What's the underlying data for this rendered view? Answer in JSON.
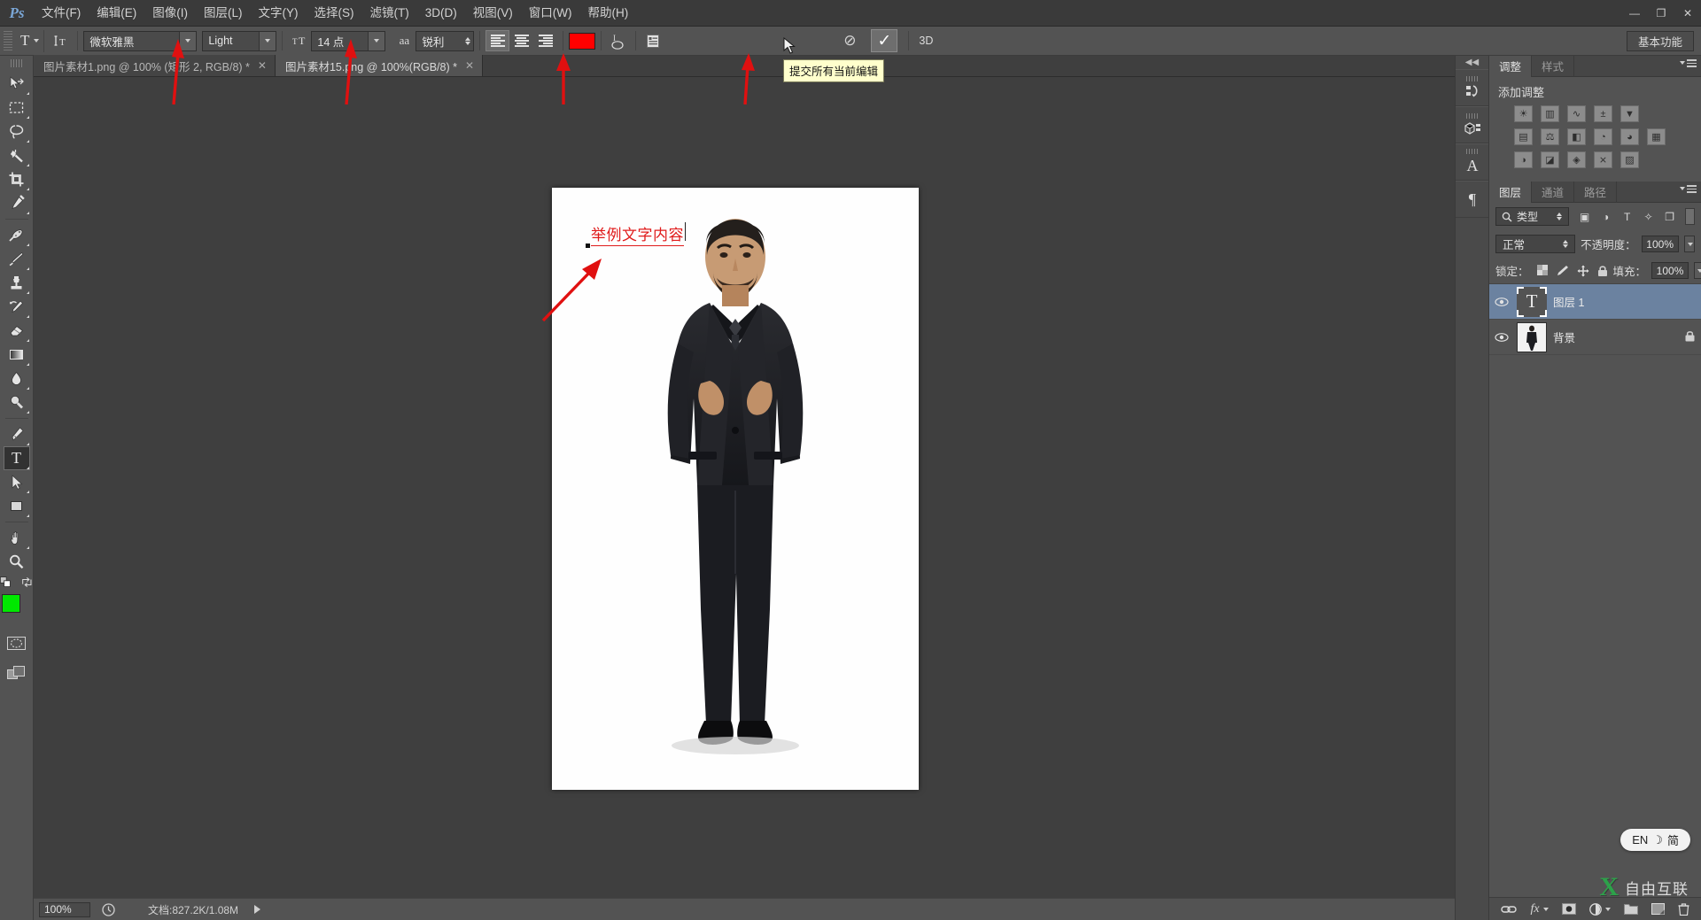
{
  "app": {
    "logo": "Ps",
    "colors": {
      "accent_blue": "#7ba7d7",
      "text_red": "#e01b1b",
      "swatch_red": "#ff0000",
      "foreground": "#00e800",
      "background": "#ffffff",
      "selected_layer": "#6b82a0"
    }
  },
  "menubar": {
    "items": [
      {
        "label": "文件(F)"
      },
      {
        "label": "编辑(E)"
      },
      {
        "label": "图像(I)"
      },
      {
        "label": "图层(L)"
      },
      {
        "label": "文字(Y)"
      },
      {
        "label": "选择(S)"
      },
      {
        "label": "滤镜(T)"
      },
      {
        "label": "3D(D)"
      },
      {
        "label": "视图(V)"
      },
      {
        "label": "窗口(W)"
      },
      {
        "label": "帮助(H)"
      }
    ],
    "window_buttons": {
      "minimize": "—",
      "restore": "❐",
      "close": "✕"
    }
  },
  "options_bar": {
    "tool_preset_glyph": "T",
    "orientation_icon": "text-orientation-icon",
    "font_family": "微软雅黑",
    "font_style": "Light",
    "font_size": "14 点",
    "antialias_label": "aa",
    "antialias_value": "锐利",
    "align_left_icon": "align-left-icon",
    "align_center_icon": "align-center-icon",
    "align_right_icon": "align-right-icon",
    "color_swatch": "#ff0000",
    "warp_text_icon": "warp-text-icon",
    "panels_icon": "character-paragraph-panels-icon",
    "cancel_glyph": "⊘",
    "commit_glyph": "✓",
    "workspace_label": "基本功能"
  },
  "tooltip": {
    "text": "提交所有当前编辑"
  },
  "document_tabs": [
    {
      "label": "图片素材1.png @ 100% (矩形 2, RGB/8) *",
      "close": "✕",
      "active": false
    },
    {
      "label": "图片素材15.png @ 100%(RGB/8) *",
      "close": "✕",
      "active": true
    }
  ],
  "toolbar": {
    "tools": [
      {
        "name": "move-tool",
        "glyph": "move"
      },
      {
        "name": "marquee-tool",
        "glyph": "marquee"
      },
      {
        "name": "lasso-tool",
        "glyph": "lasso"
      },
      {
        "name": "magic-wand-tool",
        "glyph": "wand"
      },
      {
        "name": "crop-tool",
        "glyph": "crop"
      },
      {
        "name": "eyedropper-tool",
        "glyph": "eyedropper"
      },
      {
        "name": "healing-brush-tool",
        "glyph": "healing"
      },
      {
        "name": "brush-tool",
        "glyph": "brush"
      },
      {
        "name": "clone-stamp-tool",
        "glyph": "stamp"
      },
      {
        "name": "history-brush-tool",
        "glyph": "historybrush"
      },
      {
        "name": "eraser-tool",
        "glyph": "eraser"
      },
      {
        "name": "gradient-tool",
        "glyph": "gradient"
      },
      {
        "name": "blur-tool",
        "glyph": "blur"
      },
      {
        "name": "dodge-tool",
        "glyph": "dodge"
      },
      {
        "name": "pen-tool",
        "glyph": "pen"
      },
      {
        "name": "type-tool",
        "glyph": "T",
        "active": true
      },
      {
        "name": "path-selection-tool",
        "glyph": "pathselect"
      },
      {
        "name": "rectangle-tool",
        "glyph": "rectangle"
      },
      {
        "name": "hand-tool",
        "glyph": "hand"
      },
      {
        "name": "zoom-tool",
        "glyph": "zoom"
      }
    ],
    "foreground_color": "#00e800",
    "background_color": "#ffffff",
    "quickmask_name": "quick-mask-icon",
    "screenmode_name": "screen-mode-icon"
  },
  "canvas": {
    "text_layer_content": "举例文字内容",
    "text_color": "#e01b1b"
  },
  "status_bar": {
    "zoom": "100%",
    "doc_info": "文档:827.2K/1.08M"
  },
  "right_rail": {
    "collapse_glyph": "◀◀",
    "items": [
      {
        "name": "history-panel-icon",
        "glyph": "history"
      },
      {
        "name": "3d-panel-icon",
        "glyph": "3d"
      },
      {
        "name": "character-panel-icon",
        "glyph": "A"
      },
      {
        "name": "paragraph-panel-icon",
        "glyph": "¶"
      }
    ]
  },
  "adjustments_panel": {
    "tabs": [
      {
        "label": "调整",
        "active": true
      },
      {
        "label": "样式",
        "active": false
      }
    ],
    "title": "添加调整",
    "rows": [
      [
        {
          "name": "brightness-contrast-adjustment",
          "glyph": "☀"
        },
        {
          "name": "levels-adjustment",
          "glyph": "▥"
        },
        {
          "name": "curves-adjustment",
          "glyph": "∿"
        },
        {
          "name": "exposure-adjustment",
          "glyph": "±"
        },
        {
          "name": "vibrance-adjustment",
          "glyph": "▼"
        }
      ],
      [
        {
          "name": "hue-saturation-adjustment",
          "glyph": "▤"
        },
        {
          "name": "color-balance-adjustment",
          "glyph": "⚖"
        },
        {
          "name": "black-white-adjustment",
          "glyph": "◧"
        },
        {
          "name": "photo-filter-adjustment",
          "glyph": "◔"
        },
        {
          "name": "channel-mixer-adjustment",
          "glyph": "◕"
        },
        {
          "name": "color-lookup-adjustment",
          "glyph": "▦"
        }
      ],
      [
        {
          "name": "invert-adjustment",
          "glyph": "◑"
        },
        {
          "name": "posterize-adjustment",
          "glyph": "◪"
        },
        {
          "name": "threshold-adjustment",
          "glyph": "◈"
        },
        {
          "name": "selective-color-adjustment",
          "glyph": "⨯"
        },
        {
          "name": "gradient-map-adjustment",
          "glyph": "▨"
        }
      ]
    ]
  },
  "layers_panel": {
    "tabs": [
      {
        "label": "图层",
        "active": true
      },
      {
        "label": "通道",
        "active": false
      },
      {
        "label": "路径",
        "active": false
      }
    ],
    "filter_label": "类型",
    "filter_icons": [
      {
        "name": "filter-pixel-icon",
        "glyph": "▣"
      },
      {
        "name": "filter-adjustment-icon",
        "glyph": "◑"
      },
      {
        "name": "filter-type-icon",
        "glyph": "T"
      },
      {
        "name": "filter-shape-icon",
        "glyph": "✧"
      },
      {
        "name": "filter-smart-object-icon",
        "glyph": "❐"
      }
    ],
    "blend_mode": "正常",
    "opacity_label": "不透明度：",
    "opacity_value": "100%",
    "lock_label": "锁定：",
    "lock_icons": [
      {
        "name": "lock-transparent-pixels-icon",
        "glyph": "▩"
      },
      {
        "name": "lock-image-pixels-icon",
        "glyph": "✎"
      },
      {
        "name": "lock-position-icon",
        "glyph": "✛"
      },
      {
        "name": "lock-all-icon",
        "glyph": "🔒"
      }
    ],
    "fill_label": "填充：",
    "fill_value": "100%",
    "layers": [
      {
        "name": "图层 1",
        "type": "text",
        "thumb_glyph": "T",
        "visible": true,
        "selected": true,
        "locked": false
      },
      {
        "name": "背景",
        "type": "image",
        "visible": true,
        "selected": false,
        "locked": true,
        "lock_glyph": "🔒"
      }
    ],
    "footer_buttons": [
      {
        "name": "link-layers-button",
        "glyph": "⛓"
      },
      {
        "name": "layer-style-button",
        "glyph": "fx"
      },
      {
        "name": "add-layer-mask-button",
        "glyph": "◉"
      },
      {
        "name": "new-fill-adjustment-button",
        "glyph": "◑"
      },
      {
        "name": "new-group-button",
        "glyph": "🗀"
      },
      {
        "name": "new-layer-button",
        "glyph": "❑"
      },
      {
        "name": "delete-layer-button",
        "glyph": "🗑"
      }
    ]
  },
  "ime_indicator": {
    "lang": "EN",
    "moon": "☽",
    "mode": "简"
  },
  "watermark": {
    "mark": "X",
    "text": "自由互联"
  }
}
